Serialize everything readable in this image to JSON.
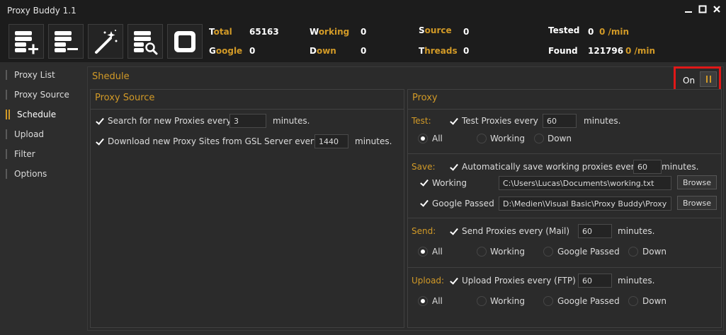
{
  "window": {
    "title": "Proxy Buddy 1.1"
  },
  "toolbar": {
    "buttons": [
      {
        "name": "add-list",
        "icon": "list-add-icon"
      },
      {
        "name": "remove-list",
        "icon": "list-remove-icon"
      },
      {
        "name": "magic",
        "icon": "magic-wand-icon"
      },
      {
        "name": "search-list",
        "icon": "list-search-icon"
      },
      {
        "name": "stop",
        "icon": "stop-icon"
      }
    ],
    "stats": {
      "total": {
        "first": "T",
        "rest": "otal",
        "value": "65163"
      },
      "google": {
        "first": "G",
        "rest": "oogle",
        "value": "0"
      },
      "working": {
        "first": "W",
        "rest": "orking",
        "value": "0"
      },
      "down": {
        "first": "D",
        "rest": "own",
        "value": "0"
      },
      "source": {
        "first": "S",
        "rest": "ource",
        "value": "0"
      },
      "threads": {
        "first": "T",
        "rest": "hreads",
        "value": "0"
      },
      "tested": {
        "label": "Tested",
        "value": "0",
        "rate": "0 /min"
      },
      "found": {
        "label": "Found",
        "value": "121796",
        "rate": "0 /min"
      }
    }
  },
  "sidebar": {
    "items": [
      {
        "label": "Proxy List"
      },
      {
        "label": "Proxy Source"
      },
      {
        "label": "Schedule",
        "active": true
      },
      {
        "label": "Upload"
      },
      {
        "label": "Filter"
      },
      {
        "label": "Options"
      }
    ]
  },
  "schedule": {
    "title": "Shedule",
    "toggle_label": "On"
  },
  "proxy_source": {
    "title": "Proxy Source",
    "search_label": "Search for new Proxies every",
    "search_value": "3",
    "search_unit": "minutes.",
    "download_label": "Download new Proxy Sites from GSL Server every",
    "download_value": "1440",
    "download_unit": "minutes."
  },
  "proxy": {
    "title": "Proxy",
    "test": {
      "section": "Test:",
      "label": "Test Proxies every",
      "value": "60",
      "unit": "minutes.",
      "options": [
        "All",
        "Working",
        "Down"
      ]
    },
    "save": {
      "section": "Save:",
      "label": "Automatically save working proxies every",
      "value": "60",
      "unit": "minutes.",
      "working_label": "Working",
      "working_path": "C:\\Users\\Lucas\\Documents\\working.txt",
      "google_label": "Google Passed",
      "google_path": "D:\\Medien\\Visual Basic\\Proxy Buddy\\Proxy Budd",
      "browse": "Browse"
    },
    "send": {
      "section": "Send:",
      "label": "Send Proxies every (Mail)",
      "value": "60",
      "unit": "minutes.",
      "options": [
        "All",
        "Working",
        "Google Passed",
        "Down"
      ]
    },
    "upload": {
      "section": "Upload:",
      "label": "Upload Proxies every (FTP)",
      "value": "60",
      "unit": "minutes.",
      "options": [
        "All",
        "Working",
        "Google Passed",
        "Down"
      ]
    }
  },
  "colors": {
    "accent": "#d29a27",
    "highlight": "#e01818",
    "background": "#2d2d2d",
    "titlebar": "#1c1c1c"
  }
}
